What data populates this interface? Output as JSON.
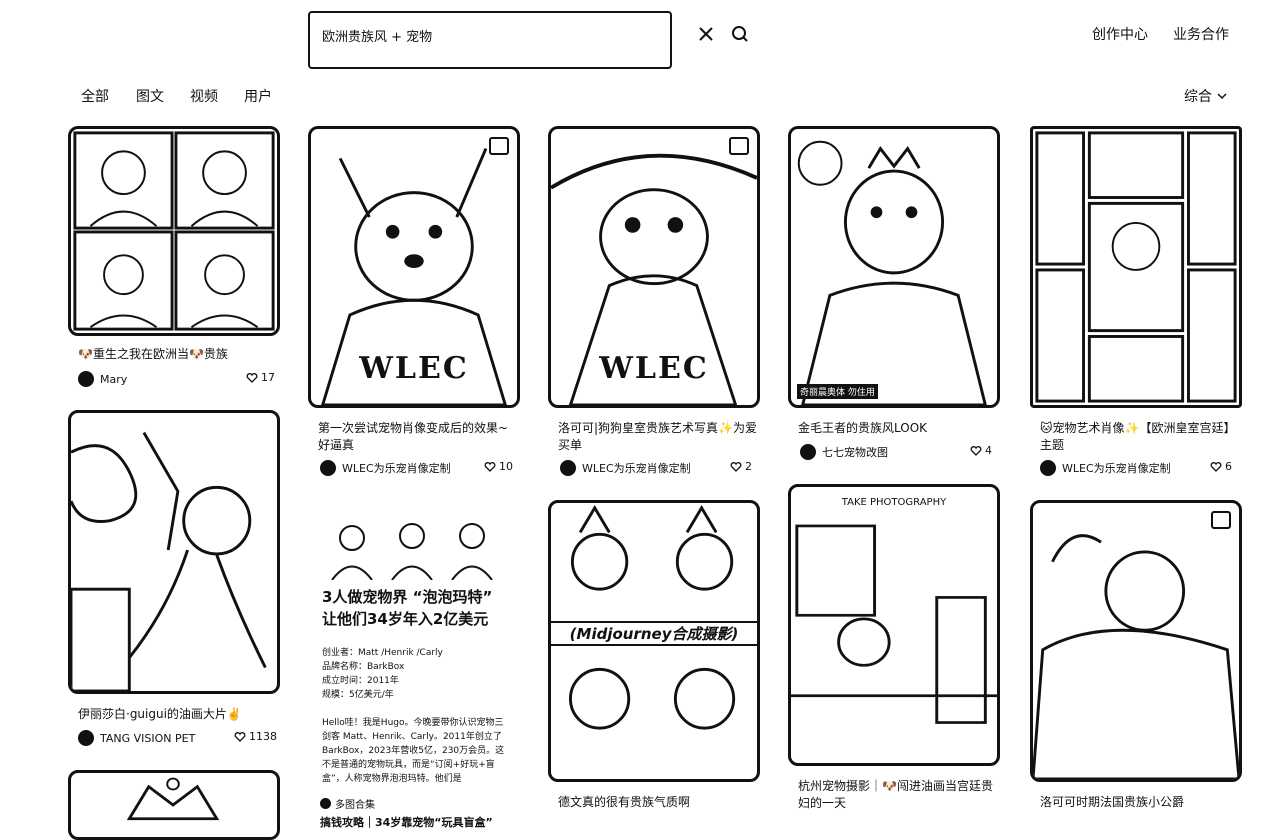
{
  "search": {
    "query": "欧洲贵族风 + 宠物"
  },
  "header": {
    "links": [
      "创作中心",
      "业务合作"
    ]
  },
  "tabs": [
    "全部",
    "图文",
    "视频",
    "用户"
  ],
  "sort": {
    "label": "综合"
  },
  "cards": [
    {
      "title": "🐶重生之我在欧洲当🐶贵族",
      "author": "Mary",
      "likes": "17"
    },
    {
      "title": "第一次尝试宠物肖像变成后的效果~好逼真",
      "author": "WLEC为乐宠肖像定制",
      "likes": "10",
      "watermark": "WLEC"
    },
    {
      "title": "洛可可|狗狗皇室贵族艺术写真✨为爱买单",
      "author": "WLEC为乐宠肖像定制",
      "likes": "2",
      "watermark": "WLEC"
    },
    {
      "title": "金毛王者的贵族风LOOK",
      "author": "七七宠物改图",
      "likes": "4",
      "tag": "奇丽晨奥体 勿住用"
    },
    {
      "title": "🐱宠物艺术肖像✨【欧洲皇室宫廷】主题",
      "author": "WLEC为乐宠肖像定制",
      "likes": "6"
    },
    {
      "title": "伊丽莎白·guigui的油画大片✌️",
      "author": "TANG VISION PET",
      "likes": "1138"
    },
    {
      "title": "德文真的很有贵族气质啊",
      "mj": "(Midjourney合成摄影)"
    },
    {
      "title": "杭州宠物摄影｜🐶闯进油画当宫廷贵妇的一天",
      "overlay": "TAKE PHOTOGRAPHY"
    },
    {
      "title": "洛可可时期法国贵族小公爵"
    }
  ],
  "text_card": {
    "headline": "3人做宠物界 “泡泡玛特” 让他们34岁年入2亿美元",
    "facts": [
      "创业者：Matt /Henrik /Carly",
      "品牌名称：BarkBox",
      "成立时间：2011年",
      "规模：5亿美元/年"
    ],
    "body": "Hello哇！我是Hugo。今晚要带你认识宠物三剑客 Matt、Henrik、Carly。2011年创立了BarkBox，2023年营收5亿，230万会员。这不是普通的宠物玩具，而是“订阅+好玩+盲盒”，人称宠物界泡泡玛特。他们是",
    "footer": "多图合集",
    "subtitle": "搞钱攻略｜34岁靠宠物“玩具盲盒”"
  },
  "colors": {
    "ink": "#111111",
    "paper": "#ffffff"
  }
}
